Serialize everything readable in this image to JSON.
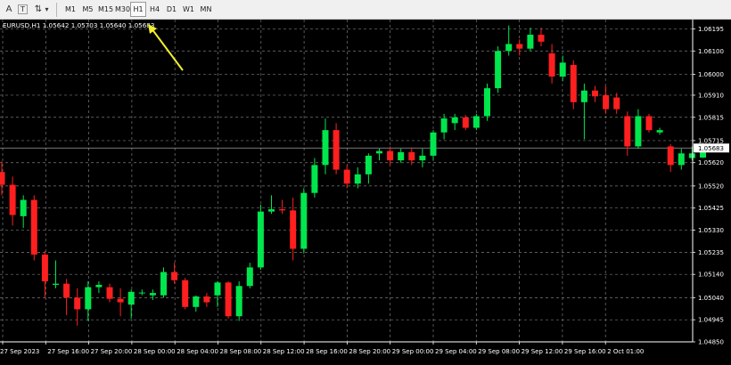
{
  "toolbar": {
    "tools": [
      {
        "name": "text-tool-icon",
        "glyph": "A"
      },
      {
        "name": "text-label-tool-icon",
        "glyph": "T"
      },
      {
        "name": "arrows-tool-icon",
        "glyph": "⇅"
      },
      {
        "name": "dropdown-arrow-icon",
        "glyph": "▾"
      }
    ],
    "timeframes": [
      "M1",
      "M5",
      "M15",
      "M30",
      "H1",
      "H4",
      "D1",
      "W1",
      "MN"
    ],
    "active_timeframe": "H1"
  },
  "chart": {
    "info_label": "EURUSD,H1  1.05642 1.05703 1.05640 1.05683",
    "current_price": "1.05683"
  },
  "colors": {
    "background": "#000000",
    "bull": "#00e64d",
    "bear": "#ff1f1f",
    "grid": "#7a7a7a",
    "axis_text": "#ffffff",
    "annotation_arrow": "#f2ee2f",
    "price_line": "#a0a0a0"
  },
  "chart_data": {
    "type": "candlestick",
    "symbol": "EURUSD",
    "timeframe": "H1",
    "ylim": [
      1.0485,
      1.06235
    ],
    "y_ticks": [
      "1.06195",
      "1.06100",
      "1.06000",
      "1.05910",
      "1.05815",
      "1.05715",
      "1.05620",
      "1.05520",
      "1.05425",
      "1.05330",
      "1.05235",
      "1.05140",
      "1.05040",
      "1.04945",
      "1.04850"
    ],
    "x_ticks": [
      "27 Sep 2023",
      "27 Sep 16:00",
      "27 Sep 20:00",
      "28 Sep 00:00",
      "28 Sep 04:00",
      "28 Sep 08:00",
      "28 Sep 12:00",
      "28 Sep 16:00",
      "28 Sep 20:00",
      "29 Sep 00:00",
      "29 Sep 04:00",
      "29 Sep 08:00",
      "29 Sep 12:00",
      "29 Sep 16:00",
      "2 Oct 01:00"
    ],
    "candles": [
      {
        "o": 1.0558,
        "h": 1.05625,
        "l": 1.0548,
        "c": 1.05525
      },
      {
        "o": 1.05525,
        "h": 1.0556,
        "l": 1.0535,
        "c": 1.05395
      },
      {
        "o": 1.0539,
        "h": 1.0548,
        "l": 1.0534,
        "c": 1.0546
      },
      {
        "o": 1.0546,
        "h": 1.0548,
        "l": 1.052,
        "c": 1.05225
      },
      {
        "o": 1.05225,
        "h": 1.0524,
        "l": 1.0504,
        "c": 1.0511
      },
      {
        "o": 1.05095,
        "h": 1.052,
        "l": 1.0508,
        "c": 1.051
      },
      {
        "o": 1.051,
        "h": 1.0512,
        "l": 1.04965,
        "c": 1.0504
      },
      {
        "o": 1.0504,
        "h": 1.0508,
        "l": 1.0492,
        "c": 1.0499
      },
      {
        "o": 1.0499,
        "h": 1.0511,
        "l": 1.0494,
        "c": 1.05085
      },
      {
        "o": 1.05085,
        "h": 1.0511,
        "l": 1.0506,
        "c": 1.05095
      },
      {
        "o": 1.05085,
        "h": 1.051,
        "l": 1.0502,
        "c": 1.05035
      },
      {
        "o": 1.05035,
        "h": 1.0508,
        "l": 1.0496,
        "c": 1.0502
      },
      {
        "o": 1.0501,
        "h": 1.05075,
        "l": 1.0495,
        "c": 1.05065
      },
      {
        "o": 1.0506,
        "h": 1.05075,
        "l": 1.0505,
        "c": 1.05062
      },
      {
        "o": 1.0505,
        "h": 1.05075,
        "l": 1.0503,
        "c": 1.0506
      },
      {
        "o": 1.0505,
        "h": 1.0517,
        "l": 1.0504,
        "c": 1.0515
      },
      {
        "o": 1.0515,
        "h": 1.0519,
        "l": 1.051,
        "c": 1.05115
      },
      {
        "o": 1.05115,
        "h": 1.05125,
        "l": 1.0499,
        "c": 1.05
      },
      {
        "o": 1.05,
        "h": 1.0505,
        "l": 1.0498,
        "c": 1.05045
      },
      {
        "o": 1.05045,
        "h": 1.0506,
        "l": 1.05,
        "c": 1.0502
      },
      {
        "o": 1.0505,
        "h": 1.0511,
        "l": 1.05,
        "c": 1.05105
      },
      {
        "o": 1.05105,
        "h": 1.0511,
        "l": 1.0495,
        "c": 1.0496
      },
      {
        "o": 1.0496,
        "h": 1.0511,
        "l": 1.0494,
        "c": 1.0509
      },
      {
        "o": 1.0509,
        "h": 1.0519,
        "l": 1.0508,
        "c": 1.0517
      },
      {
        "o": 1.0517,
        "h": 1.0544,
        "l": 1.0516,
        "c": 1.0541
      },
      {
        "o": 1.0541,
        "h": 1.0548,
        "l": 1.054,
        "c": 1.0542
      },
      {
        "o": 1.0542,
        "h": 1.0546,
        "l": 1.054,
        "c": 1.05415
      },
      {
        "o": 1.05415,
        "h": 1.0547,
        "l": 1.052,
        "c": 1.0525
      },
      {
        "o": 1.0525,
        "h": 1.0551,
        "l": 1.0523,
        "c": 1.0549
      },
      {
        "o": 1.0549,
        "h": 1.0564,
        "l": 1.0547,
        "c": 1.0561
      },
      {
        "o": 1.0561,
        "h": 1.0581,
        "l": 1.0557,
        "c": 1.0576
      },
      {
        "o": 1.0576,
        "h": 1.0579,
        "l": 1.0557,
        "c": 1.0559
      },
      {
        "o": 1.0559,
        "h": 1.0561,
        "l": 1.0551,
        "c": 1.0553
      },
      {
        "o": 1.0553,
        "h": 1.056,
        "l": 1.0551,
        "c": 1.0557
      },
      {
        "o": 1.0557,
        "h": 1.0566,
        "l": 1.0553,
        "c": 1.0565
      },
      {
        "o": 1.0566,
        "h": 1.0568,
        "l": 1.0563,
        "c": 1.0567
      },
      {
        "o": 1.0567,
        "h": 1.0569,
        "l": 1.0561,
        "c": 1.0563
      },
      {
        "o": 1.0563,
        "h": 1.0568,
        "l": 1.0562,
        "c": 1.05665
      },
      {
        "o": 1.05665,
        "h": 1.05685,
        "l": 1.0561,
        "c": 1.0563
      },
      {
        "o": 1.0563,
        "h": 1.0568,
        "l": 1.056,
        "c": 1.0565
      },
      {
        "o": 1.0565,
        "h": 1.0576,
        "l": 1.0563,
        "c": 1.0575
      },
      {
        "o": 1.0575,
        "h": 1.0583,
        "l": 1.0572,
        "c": 1.0581
      },
      {
        "o": 1.0579,
        "h": 1.0583,
        "l": 1.0576,
        "c": 1.05815
      },
      {
        "o": 1.05815,
        "h": 1.05825,
        "l": 1.0576,
        "c": 1.0577
      },
      {
        "o": 1.0577,
        "h": 1.0583,
        "l": 1.0576,
        "c": 1.0582
      },
      {
        "o": 1.0582,
        "h": 1.0596,
        "l": 1.058,
        "c": 1.0594
      },
      {
        "o": 1.0594,
        "h": 1.0612,
        "l": 1.0592,
        "c": 1.061
      },
      {
        "o": 1.061,
        "h": 1.0621,
        "l": 1.0608,
        "c": 1.0613
      },
      {
        "o": 1.0613,
        "h": 1.0615,
        "l": 1.0608,
        "c": 1.0611
      },
      {
        "o": 1.0611,
        "h": 1.062,
        "l": 1.061,
        "c": 1.0617
      },
      {
        "o": 1.0617,
        "h": 1.062,
        "l": 1.0612,
        "c": 1.0614
      },
      {
        "o": 1.0609,
        "h": 1.0613,
        "l": 1.0596,
        "c": 1.0599
      },
      {
        "o": 1.0599,
        "h": 1.0608,
        "l": 1.0597,
        "c": 1.0605
      },
      {
        "o": 1.0604,
        "h": 1.0606,
        "l": 1.0585,
        "c": 1.0588
      },
      {
        "o": 1.0588,
        "h": 1.0596,
        "l": 1.0572,
        "c": 1.0593
      },
      {
        "o": 1.0593,
        "h": 1.0595,
        "l": 1.0588,
        "c": 1.05905
      },
      {
        "o": 1.0591,
        "h": 1.0595,
        "l": 1.0583,
        "c": 1.0585
      },
      {
        "o": 1.059,
        "h": 1.0592,
        "l": 1.0583,
        "c": 1.0585
      },
      {
        "o": 1.0582,
        "h": 1.0584,
        "l": 1.0565,
        "c": 1.0569
      },
      {
        "o": 1.0569,
        "h": 1.0585,
        "l": 1.0568,
        "c": 1.0582
      },
      {
        "o": 1.0582,
        "h": 1.0583,
        "l": 1.0575,
        "c": 1.0576
      },
      {
        "o": 1.0575,
        "h": 1.0577,
        "l": 1.0574,
        "c": 1.0576
      },
      {
        "o": 1.0569,
        "h": 1.057,
        "l": 1.0558,
        "c": 1.0561
      },
      {
        "o": 1.0561,
        "h": 1.0568,
        "l": 1.0559,
        "c": 1.0566
      },
      {
        "o": 1.0564,
        "h": 1.0569,
        "l": 1.0563,
        "c": 1.0566
      },
      {
        "o": 1.05642,
        "h": 1.05703,
        "l": 1.0564,
        "c": 1.05683
      }
    ]
  }
}
